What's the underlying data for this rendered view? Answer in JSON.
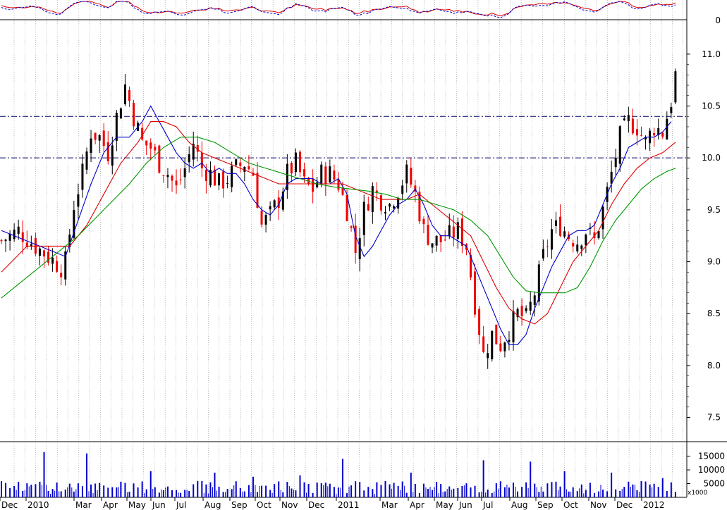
{
  "chart_data": {
    "type": "candlestick",
    "panels": [
      "oscillator",
      "price",
      "volume"
    ],
    "x_axis": {
      "tick_labels": [
        "Dec",
        "2010",
        "Mar",
        "Apr",
        "May",
        "Jun",
        "Jul",
        "Aug",
        "Sep",
        "Oct",
        "Nov",
        "Dec",
        "2011",
        "Mar",
        "Apr",
        "May",
        "Jun",
        "Jul",
        "Aug",
        "Sep",
        "Oct",
        "Nov",
        "Dec",
        "2012"
      ]
    },
    "oscillator": {
      "ticks": [
        "0"
      ],
      "zero_line": 0
    },
    "price": {
      "ylim": [
        7.3,
        11.25
      ],
      "ticks": [
        "7.5",
        "8.0",
        "8.5",
        "9.0",
        "9.5",
        "10.0",
        "10.5",
        "11.0"
      ],
      "tick_values": [
        7.5,
        8.0,
        8.5,
        9.0,
        9.5,
        10.0,
        10.5,
        11.0
      ],
      "reference_lines": [
        10.0,
        10.4
      ],
      "close_path": [
        [
          0,
          9.2
        ],
        [
          4,
          9.3
        ],
        [
          8,
          9.15
        ],
        [
          11,
          9.05
        ],
        [
          14,
          8.95
        ],
        [
          15,
          9.0
        ],
        [
          17,
          9.55
        ],
        [
          19,
          9.85
        ],
        [
          21,
          10.25
        ],
        [
          23,
          10.2
        ],
        [
          25,
          10.05
        ],
        [
          27,
          10.4
        ],
        [
          29,
          10.7
        ],
        [
          31,
          10.4
        ],
        [
          33,
          10.15
        ],
        [
          35,
          10.1
        ],
        [
          37,
          9.95
        ],
        [
          39,
          9.85
        ],
        [
          41,
          9.7
        ],
        [
          43,
          9.9
        ],
        [
          45,
          10.15
        ],
        [
          47,
          9.9
        ],
        [
          49,
          9.85
        ],
        [
          51,
          9.75
        ],
        [
          53,
          9.8
        ],
        [
          55,
          9.9
        ],
        [
          57,
          9.95
        ],
        [
          59,
          9.85
        ],
        [
          61,
          9.35
        ],
        [
          63,
          9.45
        ],
        [
          65,
          9.6
        ],
        [
          67,
          9.85
        ],
        [
          69,
          9.95
        ],
        [
          71,
          9.75
        ],
        [
          73,
          9.7
        ],
        [
          75,
          9.85
        ],
        [
          77,
          9.85
        ],
        [
          79,
          9.75
        ],
        [
          81,
          9.5
        ],
        [
          83,
          9.1
        ],
        [
          85,
          9.5
        ],
        [
          87,
          9.7
        ],
        [
          89,
          9.6
        ],
        [
          91,
          9.55
        ],
        [
          93,
          9.7
        ],
        [
          95,
          9.85
        ],
        [
          97,
          9.65
        ],
        [
          99,
          9.3
        ],
        [
          101,
          9.2
        ],
        [
          103,
          9.2
        ],
        [
          105,
          9.25
        ],
        [
          107,
          9.3
        ],
        [
          109,
          9.15
        ],
        [
          111,
          8.6
        ],
        [
          113,
          8.1
        ],
        [
          115,
          8.3
        ],
        [
          117,
          8.2
        ],
        [
          119,
          8.35
        ],
        [
          121,
          8.5
        ],
        [
          123,
          8.45
        ],
        [
          125,
          8.7
        ],
        [
          127,
          9.05
        ],
        [
          129,
          9.3
        ],
        [
          131,
          9.35
        ],
        [
          133,
          9.25
        ],
        [
          135,
          9.2
        ],
        [
          137,
          9.3
        ],
        [
          139,
          9.2
        ],
        [
          141,
          9.5
        ],
        [
          143,
          9.85
        ],
        [
          145,
          10.2
        ],
        [
          147,
          10.35
        ],
        [
          149,
          10.3
        ],
        [
          151,
          10.15
        ],
        [
          153,
          10.3
        ],
        [
          155,
          10.25
        ],
        [
          157,
          10.55
        ],
        [
          158,
          10.8
        ]
      ],
      "moving_averages": [
        {
          "color": "#0000cc",
          "values": [
            [
              0,
              9.3
            ],
            [
              6,
              9.2
            ],
            [
              12,
              9.1
            ],
            [
              15,
              9.05
            ],
            [
              18,
              9.4
            ],
            [
              21,
              9.75
            ],
            [
              24,
              10.05
            ],
            [
              27,
              10.2
            ],
            [
              30,
              10.2
            ],
            [
              33,
              10.35
            ],
            [
              35,
              10.5
            ],
            [
              37,
              10.35
            ],
            [
              39,
              10.2
            ],
            [
              41,
              10.05
            ],
            [
              43,
              9.95
            ],
            [
              45,
              9.9
            ],
            [
              47,
              9.95
            ],
            [
              49,
              9.85
            ],
            [
              51,
              9.9
            ],
            [
              53,
              9.85
            ],
            [
              55,
              9.85
            ],
            [
              57,
              9.75
            ],
            [
              59,
              9.6
            ],
            [
              61,
              9.5
            ],
            [
              63,
              9.45
            ],
            [
              65,
              9.55
            ],
            [
              67,
              9.75
            ],
            [
              69,
              9.8
            ],
            [
              71,
              9.8
            ],
            [
              73,
              9.8
            ],
            [
              75,
              9.75
            ],
            [
              77,
              9.75
            ],
            [
              79,
              9.8
            ],
            [
              81,
              9.65
            ],
            [
              83,
              9.25
            ],
            [
              85,
              9.05
            ],
            [
              87,
              9.15
            ],
            [
              89,
              9.3
            ],
            [
              91,
              9.45
            ],
            [
              93,
              9.55
            ],
            [
              95,
              9.6
            ],
            [
              97,
              9.7
            ],
            [
              99,
              9.55
            ],
            [
              101,
              9.35
            ],
            [
              103,
              9.25
            ],
            [
              105,
              9.25
            ],
            [
              107,
              9.2
            ],
            [
              109,
              9.15
            ],
            [
              111,
              8.95
            ],
            [
              113,
              8.75
            ],
            [
              115,
              8.55
            ],
            [
              117,
              8.35
            ],
            [
              119,
              8.2
            ],
            [
              121,
              8.2
            ],
            [
              123,
              8.3
            ],
            [
              125,
              8.55
            ],
            [
              127,
              8.75
            ],
            [
              129,
              8.95
            ],
            [
              131,
              9.1
            ],
            [
              133,
              9.25
            ],
            [
              135,
              9.3
            ],
            [
              137,
              9.3
            ],
            [
              139,
              9.35
            ],
            [
              141,
              9.55
            ],
            [
              143,
              9.75
            ],
            [
              145,
              9.9
            ],
            [
              147,
              10.1
            ],
            [
              149,
              10.15
            ],
            [
              151,
              10.2
            ],
            [
              153,
              10.2
            ],
            [
              155,
              10.25
            ],
            [
              157,
              10.35
            ]
          ]
        },
        {
          "color": "#dd0000",
          "values": [
            [
              0,
              8.9
            ],
            [
              6,
              9.15
            ],
            [
              12,
              9.15
            ],
            [
              16,
              9.15
            ],
            [
              20,
              9.35
            ],
            [
              24,
              9.65
            ],
            [
              28,
              9.95
            ],
            [
              32,
              10.15
            ],
            [
              35,
              10.35
            ],
            [
              38,
              10.35
            ],
            [
              41,
              10.3
            ],
            [
              44,
              10.15
            ],
            [
              47,
              10.05
            ],
            [
              50,
              10.0
            ],
            [
              53,
              9.95
            ],
            [
              56,
              9.9
            ],
            [
              59,
              9.85
            ],
            [
              62,
              9.8
            ],
            [
              65,
              9.75
            ],
            [
              68,
              9.75
            ],
            [
              71,
              9.75
            ],
            [
              74,
              9.75
            ],
            [
              77,
              9.75
            ],
            [
              80,
              9.75
            ],
            [
              83,
              9.7
            ],
            [
              86,
              9.65
            ],
            [
              89,
              9.6
            ],
            [
              92,
              9.6
            ],
            [
              95,
              9.6
            ],
            [
              98,
              9.65
            ],
            [
              101,
              9.55
            ],
            [
              104,
              9.45
            ],
            [
              107,
              9.35
            ],
            [
              110,
              9.25
            ],
            [
              113,
              9.0
            ],
            [
              116,
              8.75
            ],
            [
              119,
              8.55
            ],
            [
              122,
              8.45
            ],
            [
              125,
              8.4
            ],
            [
              128,
              8.5
            ],
            [
              131,
              8.75
            ],
            [
              134,
              9.0
            ],
            [
              137,
              9.15
            ],
            [
              140,
              9.3
            ],
            [
              143,
              9.55
            ],
            [
              146,
              9.75
            ],
            [
              149,
              9.9
            ],
            [
              152,
              10.0
            ],
            [
              155,
              10.05
            ],
            [
              158,
              10.15
            ]
          ]
        },
        {
          "color": "#009900",
          "values": [
            [
              0,
              8.65
            ],
            [
              6,
              8.85
            ],
            [
              12,
              9.05
            ],
            [
              18,
              9.25
            ],
            [
              24,
              9.5
            ],
            [
              30,
              9.75
            ],
            [
              34,
              9.95
            ],
            [
              38,
              10.1
            ],
            [
              42,
              10.2
            ],
            [
              46,
              10.2
            ],
            [
              50,
              10.15
            ],
            [
              54,
              10.05
            ],
            [
              58,
              9.95
            ],
            [
              62,
              9.9
            ],
            [
              66,
              9.85
            ],
            [
              70,
              9.8
            ],
            [
              74,
              9.75
            ],
            [
              78,
              9.72
            ],
            [
              82,
              9.7
            ],
            [
              86,
              9.68
            ],
            [
              90,
              9.65
            ],
            [
              94,
              9.6
            ],
            [
              98,
              9.6
            ],
            [
              102,
              9.55
            ],
            [
              106,
              9.5
            ],
            [
              110,
              9.4
            ],
            [
              114,
              9.25
            ],
            [
              117,
              9.05
            ],
            [
              120,
              8.85
            ],
            [
              123,
              8.72
            ],
            [
              126,
              8.7
            ],
            [
              129,
              8.7
            ],
            [
              132,
              8.7
            ],
            [
              135,
              8.75
            ],
            [
              138,
              8.95
            ],
            [
              141,
              9.2
            ],
            [
              144,
              9.4
            ],
            [
              147,
              9.55
            ],
            [
              150,
              9.7
            ],
            [
              153,
              9.8
            ],
            [
              156,
              9.87
            ],
            [
              158,
              9.9
            ]
          ]
        }
      ]
    },
    "volume": {
      "ticks": [
        "15000",
        "10000",
        "5000"
      ],
      "tick_values": [
        15000,
        10000,
        5000
      ],
      "ymax": 19000,
      "unit_label": "x1000",
      "spikes": [
        [
          10,
          16500
        ],
        [
          20,
          16000
        ],
        [
          35,
          9500
        ],
        [
          59,
          7500
        ],
        [
          80,
          14000
        ],
        [
          113,
          13500
        ],
        [
          124,
          13000
        ],
        [
          143,
          9000
        ],
        [
          96,
          9000
        ],
        [
          50,
          9000
        ],
        [
          70,
          8000
        ],
        [
          132,
          9500
        ],
        [
          155,
          7000
        ]
      ]
    }
  }
}
